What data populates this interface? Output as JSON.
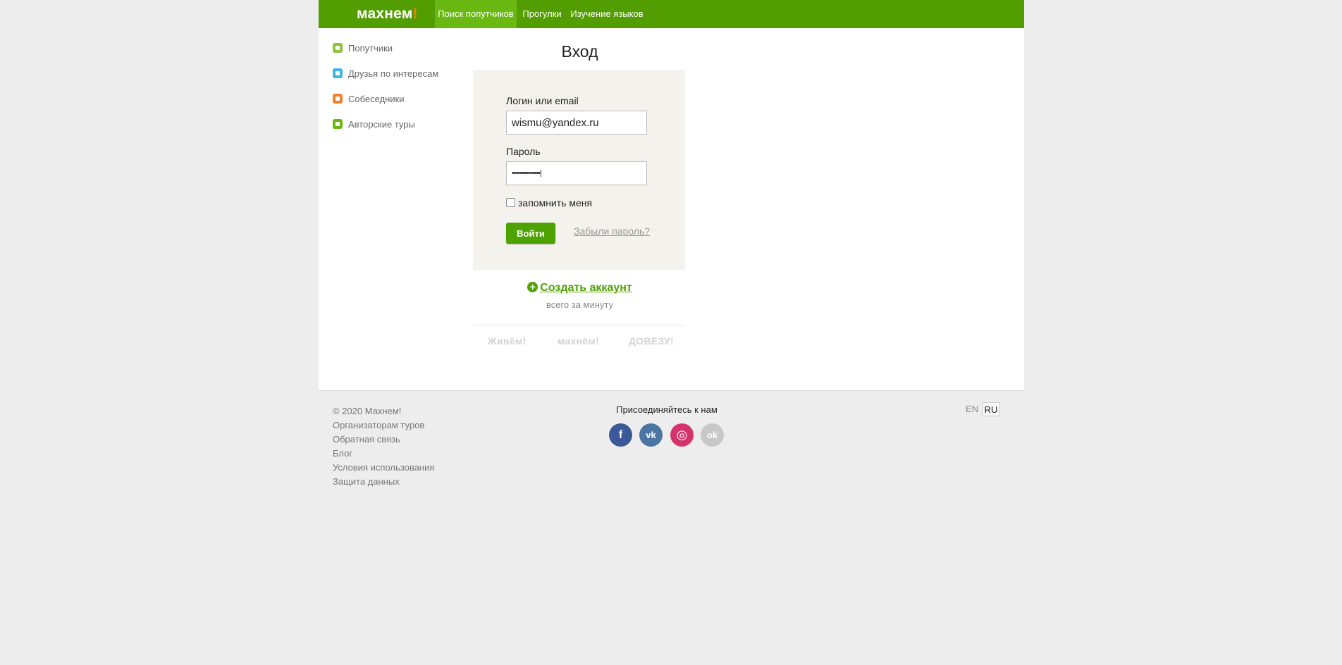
{
  "header": {
    "logo_text": "махнем",
    "logo_bang": "!",
    "nav": [
      {
        "label": "Поиск попутчиков",
        "active": true
      },
      {
        "label": "Прогулки",
        "active": false
      },
      {
        "label": "Изучение языков",
        "active": false
      }
    ]
  },
  "sidebar": {
    "items": [
      {
        "label": "Попутчики",
        "icon": "suitcase-icon",
        "color": "#8cc43c"
      },
      {
        "label": "Друзья по интересам",
        "icon": "building-icon",
        "color": "#3cb4e6"
      },
      {
        "label": "Собеседники",
        "icon": "chat-bubble-icon",
        "color": "#f0822d"
      },
      {
        "label": "Авторские туры",
        "icon": "leaf-icon",
        "color": "#6ab812"
      }
    ]
  },
  "login": {
    "title": "Вход",
    "login_label": "Логин или email",
    "login_value": "wismu@yandex.ru",
    "password_label": "Пароль",
    "password_value": "••••••••••••••|",
    "remember_label": "запомнить меня",
    "submit_label": "Войти",
    "forgot_label": "Забыли пароль?"
  },
  "signup": {
    "plus": "+",
    "link": "Создать аккаунт",
    "subtitle": "всего за минуту"
  },
  "partners": [
    "Живём!",
    "махнём!",
    "ДОВЕЗУ!"
  ],
  "footer": {
    "copyright": "© 2020 Махнем!",
    "links": [
      "Организаторам туров",
      "Обратная связь",
      "Блог",
      "Условия использования",
      "Защита данных"
    ],
    "join_label": "Присоединяйтесь к нам",
    "social": [
      {
        "name": "facebook",
        "glyph": "f",
        "color": "#3b5998"
      },
      {
        "name": "vk",
        "glyph": "vk",
        "color": "#4c75a3"
      },
      {
        "name": "instagram",
        "glyph": "◎",
        "color": "#d6336c"
      },
      {
        "name": "odnoklassniki",
        "glyph": "ok",
        "color": "#c8c8c8"
      }
    ],
    "languages": [
      "EN",
      "RU"
    ],
    "active_language": "RU"
  },
  "colors": {
    "brand_green": "#529d00",
    "active_nav": "#6ab812",
    "logo_accent": "#ff7a00",
    "login_panel": "#f3f2ec"
  }
}
